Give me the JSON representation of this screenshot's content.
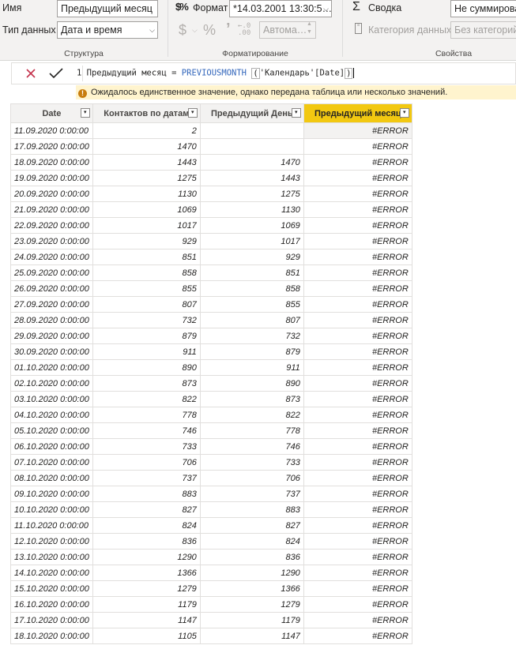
{
  "ribbon": {
    "name_label": "Имя",
    "name_value": "Предыдущий месяц",
    "datatype_label": "Тип данных",
    "datatype_value": "Дата и время",
    "format_label": "Формат",
    "format_value": "*14.03.2001 13:30:5…",
    "auto_label": "Автома…",
    "summary_label": "Сводка",
    "summary_value": "Не суммирова",
    "category_label": "Категория данных",
    "category_value": "Без категорий",
    "group_structure": "Структура",
    "group_formatting": "Форматирование",
    "group_properties": "Свойства",
    "icons": [
      "format-dollar-percent-icon",
      "currency-icon",
      "percent-icon",
      "comma-icon",
      "decimal-places-icon",
      "sigma-icon",
      "data-category-icon"
    ]
  },
  "formula": {
    "line_number": "1",
    "measure_name": "Предыдущий месяц",
    "equals": "=",
    "function": "PREVIOUSMONTH",
    "open_paren": "(",
    "argument": "'Календарь'[Date]",
    "close_paren": ")",
    "error": "Ожидалось единственное значение, однако передана таблица или несколько значений."
  },
  "table": {
    "columns": [
      "Date",
      "Контактов по датам",
      "Предыдущий День",
      "Предыдущий месяц"
    ],
    "rows": [
      [
        "11.09.2020 0:00:00",
        "2",
        "",
        "#ERROR"
      ],
      [
        "17.09.2020 0:00:00",
        "1470",
        "",
        "#ERROR"
      ],
      [
        "18.09.2020 0:00:00",
        "1443",
        "1470",
        "#ERROR"
      ],
      [
        "19.09.2020 0:00:00",
        "1275",
        "1443",
        "#ERROR"
      ],
      [
        "20.09.2020 0:00:00",
        "1130",
        "1275",
        "#ERROR"
      ],
      [
        "21.09.2020 0:00:00",
        "1069",
        "1130",
        "#ERROR"
      ],
      [
        "22.09.2020 0:00:00",
        "1017",
        "1069",
        "#ERROR"
      ],
      [
        "23.09.2020 0:00:00",
        "929",
        "1017",
        "#ERROR"
      ],
      [
        "24.09.2020 0:00:00",
        "851",
        "929",
        "#ERROR"
      ],
      [
        "25.09.2020 0:00:00",
        "858",
        "851",
        "#ERROR"
      ],
      [
        "26.09.2020 0:00:00",
        "855",
        "858",
        "#ERROR"
      ],
      [
        "27.09.2020 0:00:00",
        "807",
        "855",
        "#ERROR"
      ],
      [
        "28.09.2020 0:00:00",
        "732",
        "807",
        "#ERROR"
      ],
      [
        "29.09.2020 0:00:00",
        "879",
        "732",
        "#ERROR"
      ],
      [
        "30.09.2020 0:00:00",
        "911",
        "879",
        "#ERROR"
      ],
      [
        "01.10.2020 0:00:00",
        "890",
        "911",
        "#ERROR"
      ],
      [
        "02.10.2020 0:00:00",
        "873",
        "890",
        "#ERROR"
      ],
      [
        "03.10.2020 0:00:00",
        "822",
        "873",
        "#ERROR"
      ],
      [
        "04.10.2020 0:00:00",
        "778",
        "822",
        "#ERROR"
      ],
      [
        "05.10.2020 0:00:00",
        "746",
        "778",
        "#ERROR"
      ],
      [
        "06.10.2020 0:00:00",
        "733",
        "746",
        "#ERROR"
      ],
      [
        "07.10.2020 0:00:00",
        "706",
        "733",
        "#ERROR"
      ],
      [
        "08.10.2020 0:00:00",
        "737",
        "706",
        "#ERROR"
      ],
      [
        "09.10.2020 0:00:00",
        "883",
        "737",
        "#ERROR"
      ],
      [
        "10.10.2020 0:00:00",
        "827",
        "883",
        "#ERROR"
      ],
      [
        "11.10.2020 0:00:00",
        "824",
        "827",
        "#ERROR"
      ],
      [
        "12.10.2020 0:00:00",
        "836",
        "824",
        "#ERROR"
      ],
      [
        "13.10.2020 0:00:00",
        "1290",
        "836",
        "#ERROR"
      ],
      [
        "14.10.2020 0:00:00",
        "1366",
        "1290",
        "#ERROR"
      ],
      [
        "15.10.2020 0:00:00",
        "1279",
        "1366",
        "#ERROR"
      ],
      [
        "16.10.2020 0:00:00",
        "1179",
        "1279",
        "#ERROR"
      ],
      [
        "17.10.2020 0:00:00",
        "1147",
        "1179",
        "#ERROR"
      ],
      [
        "18.10.2020 0:00:00",
        "1105",
        "1147",
        "#ERROR"
      ]
    ],
    "active_column_color": "#f2c811"
  }
}
